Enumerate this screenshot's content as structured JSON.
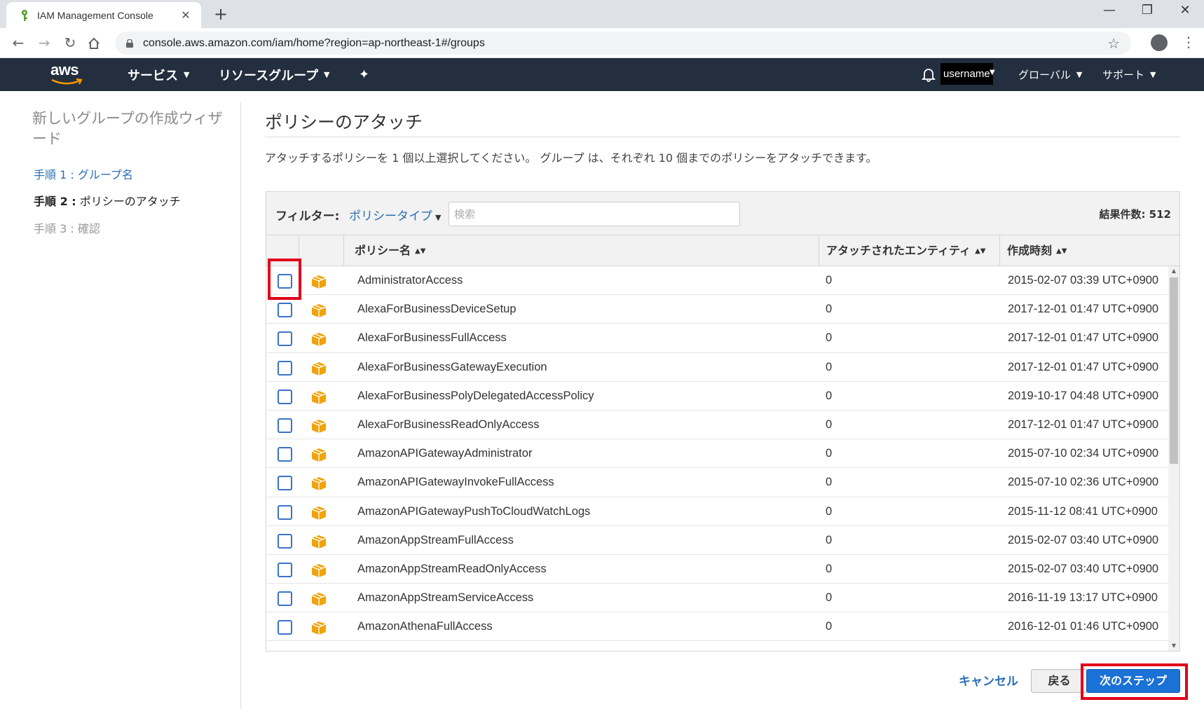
{
  "browser": {
    "tab_title": "IAM Management Console",
    "new_tab": "+",
    "close_tab": "✕",
    "url": "console.aws.amazon.com/iam/home?region=ap-northeast-1#/groups",
    "window_controls": [
      "—",
      "❐",
      "✕"
    ]
  },
  "aws_nav": {
    "logo": "aws",
    "services": "サービス",
    "resource_groups": "リソースグループ",
    "username": "username",
    "global": "グローバル",
    "support": "サポート"
  },
  "wizard": {
    "title": "新しいグループの作成ウィザード",
    "steps": [
      {
        "label": "手順 1 : グループ名",
        "state": "link"
      },
      {
        "label_bold": "手順 2 :",
        "label_rest": " ポリシーのアタッチ",
        "state": "current"
      },
      {
        "label": "手順 3 : 確認",
        "state": "disabled"
      }
    ]
  },
  "main": {
    "title": "ポリシーのアタッチ",
    "description": "アタッチするポリシーを 1 個以上選択してください。 グループ は、それぞれ 10 個までのポリシーをアタッチできます。",
    "filter_label": "フィルター:",
    "filter_type": "ポリシータイプ",
    "search_placeholder": "検索",
    "result_count": "結果件数: 512",
    "columns": {
      "name": "ポリシー名",
      "entities": "アタッチされたエンティティ",
      "created": "作成時刻"
    },
    "rows": [
      {
        "name": "AdministratorAccess",
        "entities": "0",
        "created": "2015-02-07 03:39 UTC+0900"
      },
      {
        "name": "AlexaForBusinessDeviceSetup",
        "entities": "0",
        "created": "2017-12-01 01:47 UTC+0900"
      },
      {
        "name": "AlexaForBusinessFullAccess",
        "entities": "0",
        "created": "2017-12-01 01:47 UTC+0900"
      },
      {
        "name": "AlexaForBusinessGatewayExecution",
        "entities": "0",
        "created": "2017-12-01 01:47 UTC+0900"
      },
      {
        "name": "AlexaForBusinessPolyDelegatedAccessPolicy",
        "entities": "0",
        "created": "2019-10-17 04:48 UTC+0900"
      },
      {
        "name": "AlexaForBusinessReadOnlyAccess",
        "entities": "0",
        "created": "2017-12-01 01:47 UTC+0900"
      },
      {
        "name": "AmazonAPIGatewayAdministrator",
        "entities": "0",
        "created": "2015-07-10 02:34 UTC+0900"
      },
      {
        "name": "AmazonAPIGatewayInvokeFullAccess",
        "entities": "0",
        "created": "2015-07-10 02:36 UTC+0900"
      },
      {
        "name": "AmazonAPIGatewayPushToCloudWatchLogs",
        "entities": "0",
        "created": "2015-11-12 08:41 UTC+0900"
      },
      {
        "name": "AmazonAppStreamFullAccess",
        "entities": "0",
        "created": "2015-02-07 03:40 UTC+0900"
      },
      {
        "name": "AmazonAppStreamReadOnlyAccess",
        "entities": "0",
        "created": "2015-02-07 03:40 UTC+0900"
      },
      {
        "name": "AmazonAppStreamServiceAccess",
        "entities": "0",
        "created": "2016-11-19 13:17 UTC+0900"
      },
      {
        "name": "AmazonAthenaFullAccess",
        "entities": "0",
        "created": "2016-12-01 01:46 UTC+0900"
      }
    ]
  },
  "footer": {
    "cancel": "キャンセル",
    "back": "戻る",
    "next": "次のステップ"
  },
  "colors": {
    "aws_nav_bg": "#232f3e",
    "link_blue": "#2a6fb5",
    "primary_button": "#1a71d6",
    "highlight_red": "#e0001b",
    "policy_icon": "#f0a30a"
  }
}
